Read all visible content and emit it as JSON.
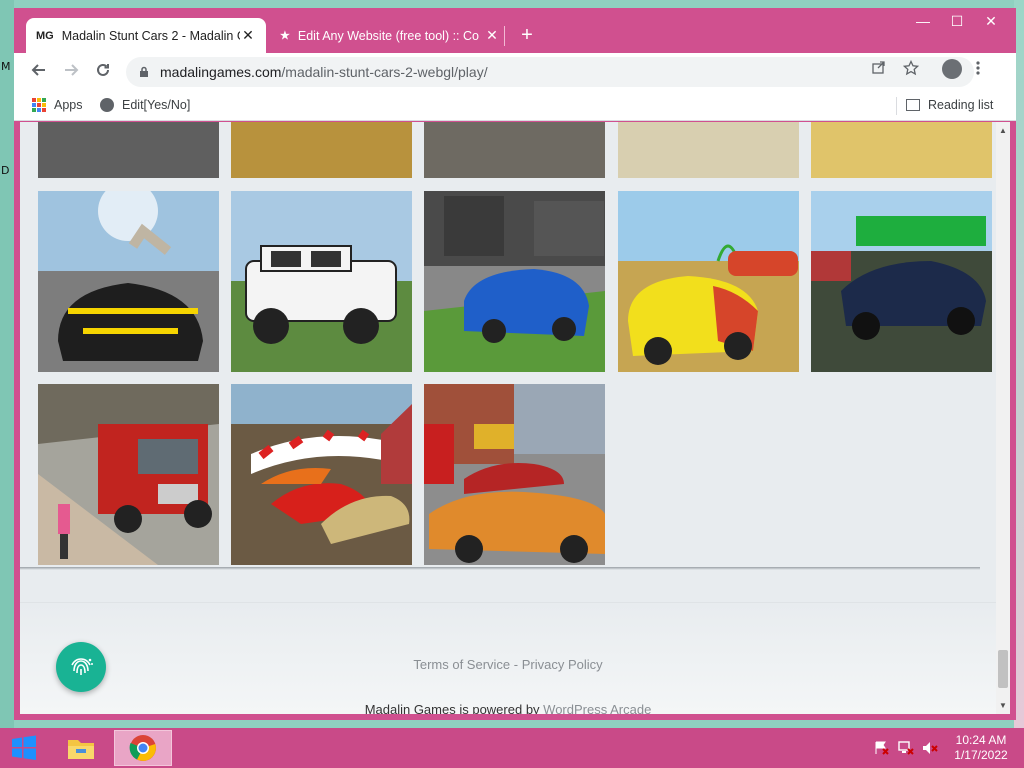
{
  "desktop": {
    "left_glyphs": [
      "M",
      "D"
    ]
  },
  "tabs": [
    {
      "favicon": "MG",
      "title": "Madalin Stunt Cars 2 - Madalin G",
      "close": "✕",
      "active": true
    },
    {
      "favicon": "★",
      "title": "Edit Any Website (free tool) :: Co",
      "close": "✕",
      "active": false
    }
  ],
  "new_tab": "+",
  "window_controls": {
    "minimize": "—",
    "maximize": "☐",
    "close": "✕"
  },
  "address_bar": {
    "domain": "madalingames.com",
    "path": "/madalin-stunt-cars-2-webgl/play/"
  },
  "bookmarks": {
    "apps": "Apps",
    "edit": "Edit[Yes/No]",
    "reading_list": "Reading list"
  },
  "footer": {
    "terms": "Terms of Service",
    "separator": " - ",
    "privacy": "Privacy Policy",
    "powered_prefix": "Madalin Games is powered by ",
    "powered_link": "WordPress Arcade"
  },
  "game_thumbnails": [
    {
      "name": "thumb-row0-1",
      "icon": "monster-truck-icon",
      "bg": "#7a7a7a"
    },
    {
      "name": "thumb-row0-2",
      "icon": "orange-car-icon",
      "bg": "#b8923d"
    },
    {
      "name": "thumb-row0-3",
      "icon": "asphalt-icon",
      "bg": "#6e6a62"
    },
    {
      "name": "thumb-row0-4",
      "icon": "motorbike-icon",
      "bg": "#d8cfb0"
    },
    {
      "name": "thumb-row0-5",
      "icon": "dirt-bike-icon",
      "bg": "#e0c46a"
    },
    {
      "name": "thumb-yellow-supercar",
      "icon": "supercar-icon",
      "bg": "#8fa3b0"
    },
    {
      "name": "thumb-white-suv",
      "icon": "suv-icon",
      "bg": "#5d8b40"
    },
    {
      "name": "thumb-blue-bmw",
      "icon": "sedan-icon",
      "bg": "#5a5a5a"
    },
    {
      "name": "thumb-yellow-hatchback",
      "icon": "hatchback-icon",
      "bg": "#c6a552"
    },
    {
      "name": "thumb-dark-sports-car",
      "icon": "sports-car-icon",
      "bg": "#3f4a3a"
    },
    {
      "name": "thumb-fire-truck",
      "icon": "fire-truck-icon",
      "bg": "#a5a49c"
    },
    {
      "name": "thumb-stunt-ramps",
      "icon": "ramp-icon",
      "bg": "#6b5a44"
    },
    {
      "name": "thumb-orange-roadster",
      "icon": "roadster-icon",
      "bg": "#8d8d8d"
    }
  ],
  "taskbar": {
    "clock_time": "10:24 AM",
    "clock_date": "1/17/2022",
    "items": [
      "file-explorer-icon",
      "chrome-icon"
    ]
  }
}
